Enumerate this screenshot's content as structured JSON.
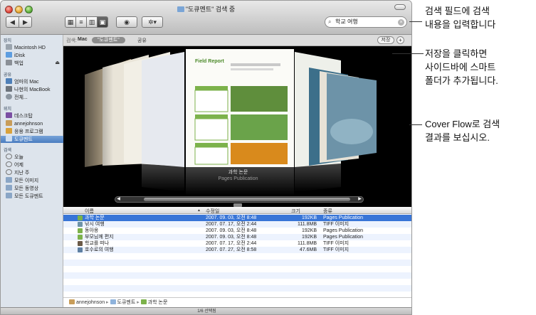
{
  "window": {
    "title": "\"도큐멘트\" 검색 중",
    "search_value": "학교 여행",
    "status": "1/6 선택됨"
  },
  "toolbar": {
    "back_icon": "chevron-left-icon",
    "forward_icon": "chevron-right-icon",
    "eye_icon": "eye-icon",
    "action_icon": "gear-icon"
  },
  "sidebar": {
    "sections": [
      {
        "label": "장치",
        "items": [
          "Macintosh HD",
          "iDisk",
          "백업"
        ]
      },
      {
        "label": "공유",
        "items": [
          "엄마의 Mac",
          "나현의 MacBook",
          "전체..."
        ]
      },
      {
        "label": "위치",
        "items": [
          "데스크탑",
          "annejohnson",
          "응용 프로그램",
          "도큐멘트"
        ]
      },
      {
        "label": "검색",
        "items": [
          "오늘",
          "어제",
          "지난 주",
          "모든 이미지",
          "모든 동영상",
          "모든 도큐멘트"
        ]
      }
    ]
  },
  "scope": {
    "label": "검색:",
    "mac": "Mac",
    "this": "\"도큐멘트\"",
    "shared": "공유",
    "save": "저장",
    "add": "+"
  },
  "coverflow": {
    "title": "과학 논문",
    "kind": "Pages Publication",
    "doc_heading": "Field Report"
  },
  "list": {
    "columns": [
      "이름",
      "수정일",
      "크기",
      "종류"
    ],
    "rows": [
      {
        "name": "과학 논문",
        "date": "2007. 09. 03, 오전 8:48",
        "size": "192KB",
        "kind": "Pages Publication"
      },
      {
        "name": "낚시 여행",
        "date": "2007. 07. 17, 오전 2:44",
        "size": "111.8MB",
        "kind": "TIFF 이미지"
      },
      {
        "name": "동아옹",
        "date": "2007. 09. 03, 오전 8:48",
        "size": "192KB",
        "kind": "Pages Publication"
      },
      {
        "name": "부모님께 편지",
        "date": "2007. 09. 03, 오전 8:48",
        "size": "192KB",
        "kind": "Pages Publication"
      },
      {
        "name": "학교를 떠나",
        "date": "2007. 07. 17, 오전 2:44",
        "size": "111.8MB",
        "kind": "TIFF 이미지"
      },
      {
        "name": "호수로의 여행",
        "date": "2007. 07. 27, 오전 8:58",
        "size": "47.6MB",
        "kind": "TIFF 이미지"
      }
    ]
  },
  "pathbar": [
    "annejohnson",
    "도큐멘트",
    "과학 논문"
  ],
  "callouts": {
    "search": "검색 필드에 검색\n내용을 입력합니다",
    "save": "저장을 클릭하면\n사이드바에 스마트\n폴더가 추가됩니다.",
    "coverflow": "Cover Flow로 검색\n결과를 보십시오."
  }
}
